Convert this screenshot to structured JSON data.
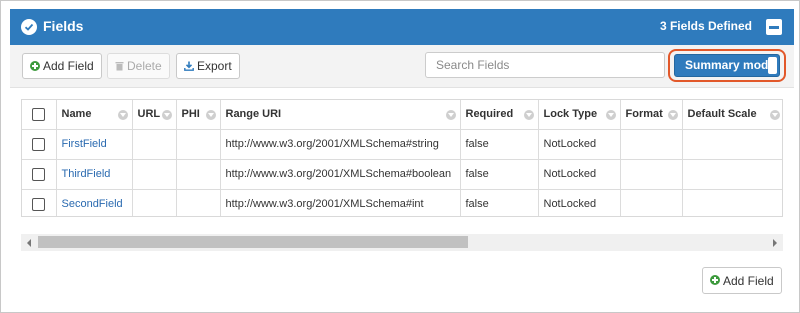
{
  "header": {
    "title": "Fields",
    "count_text": "3 Fields Defined",
    "accent_color": "#2f7bbd"
  },
  "toolbar": {
    "add_field_label": "Add Field",
    "delete_label": "Delete",
    "export_label": "Export",
    "search_placeholder": "Search Fields",
    "summary_mode_label": "Summary mode"
  },
  "grid": {
    "columns": [
      "Name",
      "URL",
      "PHI",
      "Range URI",
      "Required",
      "Lock Type",
      "Format",
      "Default Scale"
    ],
    "rows": [
      {
        "name": "FirstField",
        "url": "",
        "phi": "",
        "range_uri": "http://www.w3.org/2001/XMLSchema#string",
        "required": "false",
        "lock_type": "NotLocked",
        "format": "",
        "default_scale": ""
      },
      {
        "name": "ThirdField",
        "url": "",
        "phi": "",
        "range_uri": "http://www.w3.org/2001/XMLSchema#boolean",
        "required": "false",
        "lock_type": "NotLocked",
        "format": "",
        "default_scale": ""
      },
      {
        "name": "SecondField",
        "url": "",
        "phi": "",
        "range_uri": "http://www.w3.org/2001/XMLSchema#int",
        "required": "false",
        "lock_type": "NotLocked",
        "format": "",
        "default_scale": ""
      }
    ]
  },
  "footer": {
    "add_field_label": "Add Field"
  }
}
